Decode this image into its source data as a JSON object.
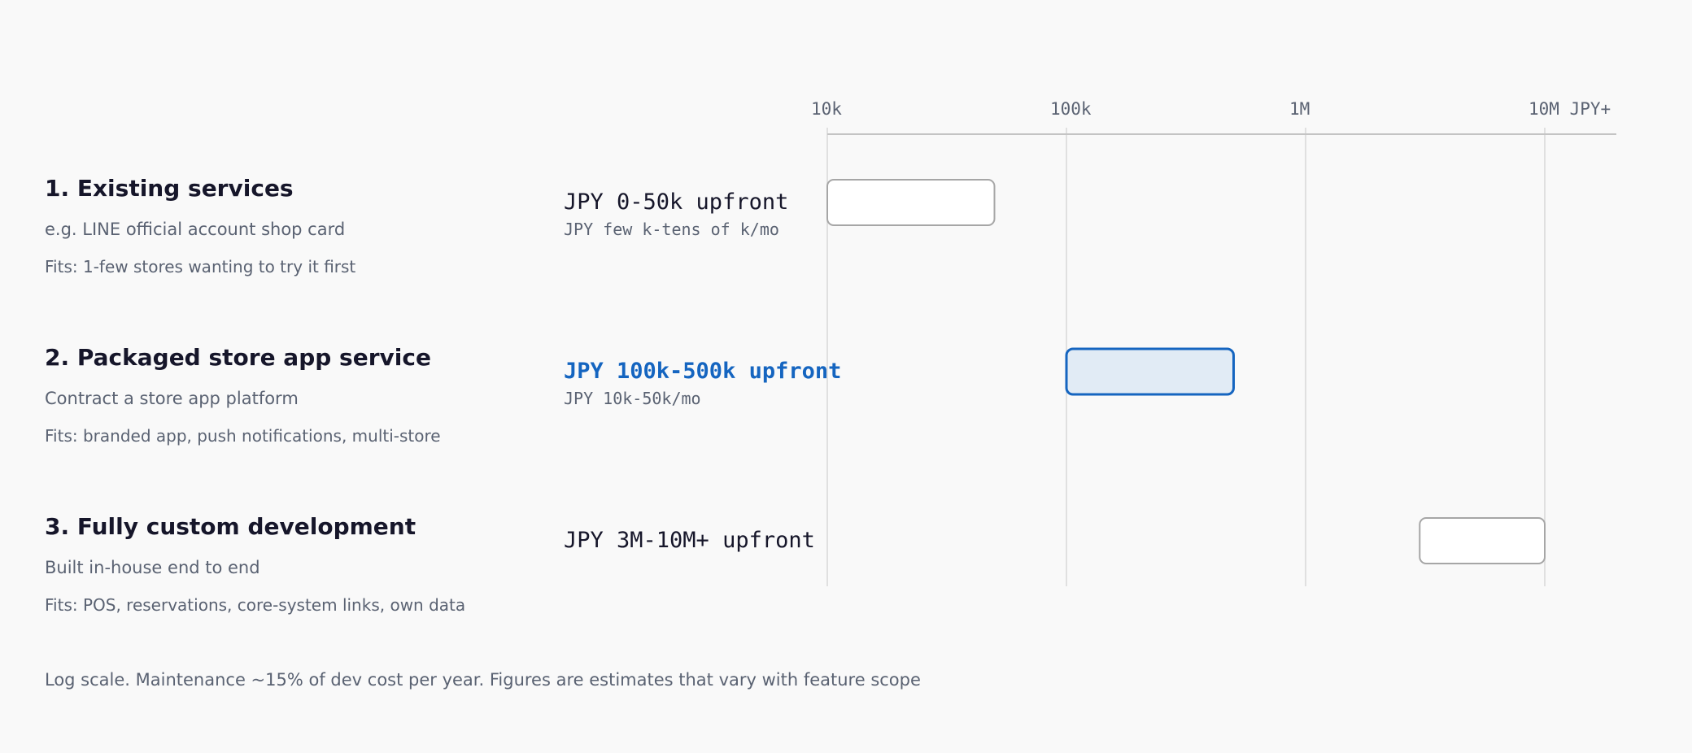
{
  "chart_data": {
    "type": "bar",
    "orientation": "horizontal",
    "scale": "log",
    "xlim": [
      10000,
      10000000
    ],
    "ticks": [
      {
        "value": 10000,
        "label": "10k"
      },
      {
        "value": 100000,
        "label": "100k"
      },
      {
        "value": 1000000,
        "label": "1M"
      },
      {
        "value": 10000000,
        "label": "10M JPY+"
      }
    ],
    "grid": true,
    "rows": [
      {
        "title": "1. Existing services",
        "subtitle": "e.g. LINE official account shop card",
        "fits": "Fits: 1-few stores wanting to try it first",
        "price": "JPY 0-50k upfront",
        "monthly": "JPY few k-tens of k/mo",
        "range": [
          10000,
          50000
        ],
        "highlight": false
      },
      {
        "title": "2. Packaged store app service",
        "subtitle": "Contract a store app platform",
        "fits": "Fits: branded app, push notifications, multi-store",
        "price": "JPY 100k-500k upfront",
        "monthly": "JPY 10k-50k/mo",
        "range": [
          100000,
          500000
        ],
        "highlight": true
      },
      {
        "title": "3. Fully custom development",
        "subtitle": "Built in-house end to end",
        "fits": "Fits: POS, reservations, core-system links, own data",
        "price": "JPY 3M-10M+ upfront",
        "monthly": "",
        "range": [
          3000000,
          10000000
        ],
        "highlight": false
      }
    ],
    "footnote": "Log scale. Maintenance ~15% of dev cost per year. Figures are estimates that vary with feature scope"
  },
  "colors": {
    "highlight_stroke": "#1565c0",
    "highlight_fill": "#e1ebf5",
    "normal_stroke": "#a6a6a6",
    "normal_fill": "#ffffff",
    "grid": "#d8d8d8",
    "axis": "#c4c4c4"
  }
}
